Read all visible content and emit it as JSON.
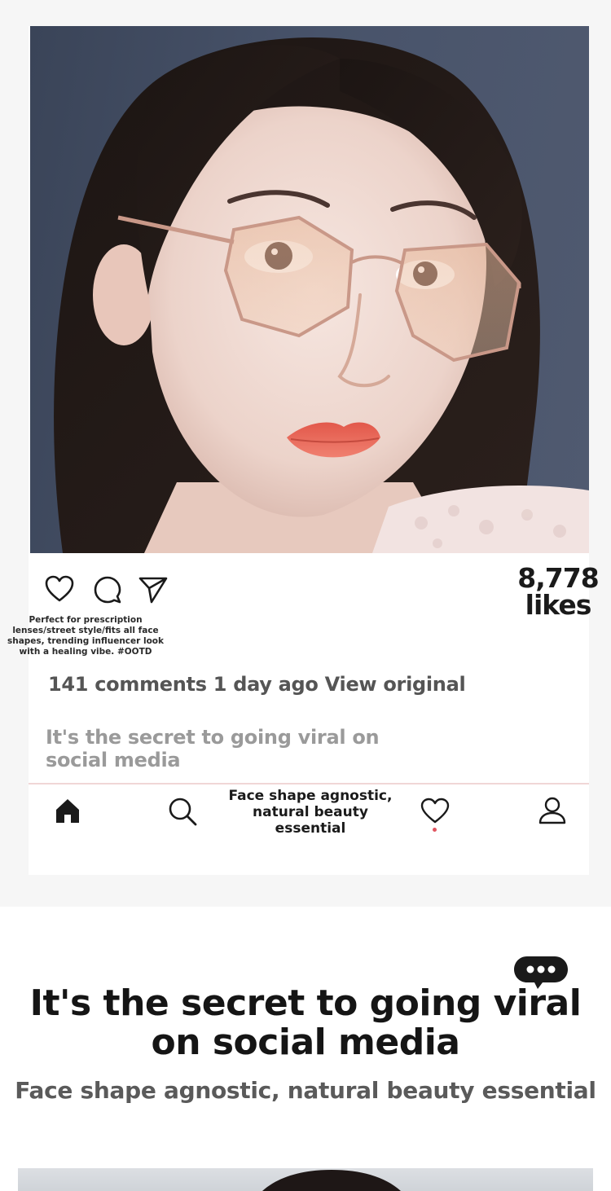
{
  "post": {
    "likes_count": "8,778",
    "likes_label": "likes",
    "caption": "Perfect for prescription lenses/street style/fits all face shapes, trending influencer look with a healing vibe. #OOTD",
    "comments_line": "141 comments 1 day ago View original",
    "subtext": "It's the secret to going viral on social media"
  },
  "actions": [
    {
      "name": "heart-icon"
    },
    {
      "name": "comment-icon"
    },
    {
      "name": "send-icon"
    }
  ],
  "bottom_nav": {
    "items": [
      "home-icon",
      "search-icon",
      "heart-icon",
      "profile-icon"
    ],
    "center_text": "Face shape agnostic, natural beauty essential"
  },
  "feature": {
    "headline": "It's the secret to going viral on social media",
    "tagline": "Face shape agnostic, natural beauty essential"
  },
  "colors": {
    "background_gray": "#f6f6f6",
    "divider": "#f0d6d6",
    "notification_dot": "#e05560",
    "text_dark": "#151515",
    "text_muted": "#9a9a9a"
  }
}
